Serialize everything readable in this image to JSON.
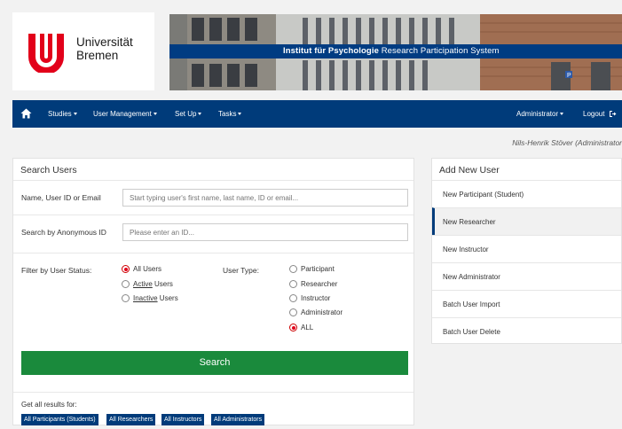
{
  "header": {
    "university_name_line1": "Universität",
    "university_name_line2": "Bremen",
    "banner_title_bold": "Institut für Psychologie",
    "banner_title_rest": " Research Participation System"
  },
  "navbar": {
    "home_icon": "home-icon",
    "studies": "Studies",
    "user_management": "User Management",
    "set_up": "Set Up",
    "tasks": "Tasks",
    "administrator": "Administrator",
    "logout": "Logout",
    "logout_icon": "logout-icon"
  },
  "user_display": "Nils-Henrik Stöver (Administrator",
  "search_panel": {
    "title": "Search Users",
    "name_label": "Name, User ID or Email",
    "name_placeholder": "Start typing user's first name, last name, ID or email...",
    "anon_label": "Search by Anonymous ID",
    "anon_placeholder": "Please enter an ID...",
    "status_label": "Filter by User Status:",
    "status_options": [
      {
        "label": "All Users",
        "checked": true
      },
      {
        "label": "Active",
        "suffix": " Users",
        "checked": false
      },
      {
        "label": "Inactive",
        "suffix": " Users",
        "checked": false
      }
    ],
    "type_label": "User Type:",
    "type_options": [
      {
        "label": "Participant",
        "checked": false
      },
      {
        "label": "Researcher",
        "checked": false
      },
      {
        "label": "Instructor",
        "checked": false
      },
      {
        "label": "Administrator",
        "checked": false
      },
      {
        "label": "ALL",
        "checked": true
      }
    ],
    "search_button": "Search",
    "all_results_label": "Get all results for:",
    "result_links": [
      "All Participants (Students)",
      "All Researchers",
      "All Instructors",
      "All Administrators"
    ]
  },
  "add_panel": {
    "title": "Add New User",
    "items": [
      "New Participant (Student)",
      "New Researcher",
      "New Instructor",
      "New Administrator",
      "Batch User Import",
      "Batch User Delete"
    ],
    "active_item": "New Researcher"
  },
  "colors": {
    "brand_navy": "#003b7a",
    "uni_red": "#e2001a",
    "search_green": "#1a8a3c"
  }
}
